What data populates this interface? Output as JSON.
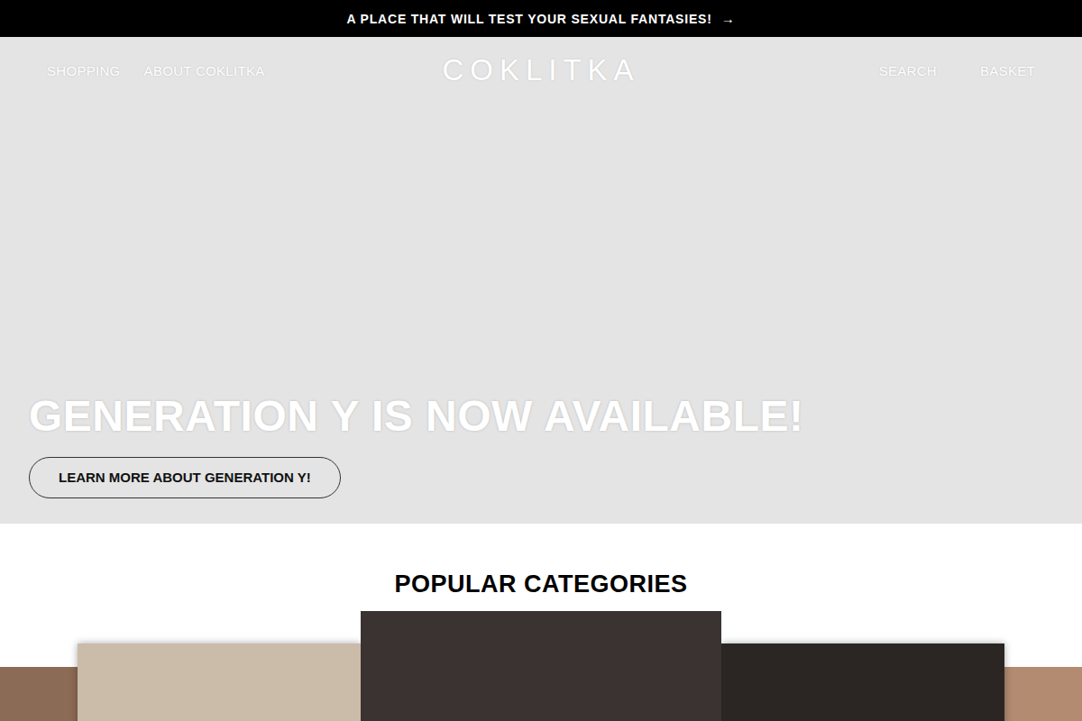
{
  "announcement": {
    "text": "A PLACE THAT WILL TEST YOUR SEXUAL FANTASIES!",
    "arrow": "→"
  },
  "header": {
    "nav_left": [
      "SHOPPING",
      "ABOUT COKLITKA"
    ],
    "logo": "COKLITKA",
    "nav_right": [
      "SEARCH",
      "BASKET"
    ]
  },
  "hero": {
    "title": "GENERATION Y IS NOW AVAILABLE!",
    "button": "LEARN MORE ABOUT GENERATION Y!"
  },
  "categories": {
    "title": "POPULAR CATEGORIES"
  }
}
